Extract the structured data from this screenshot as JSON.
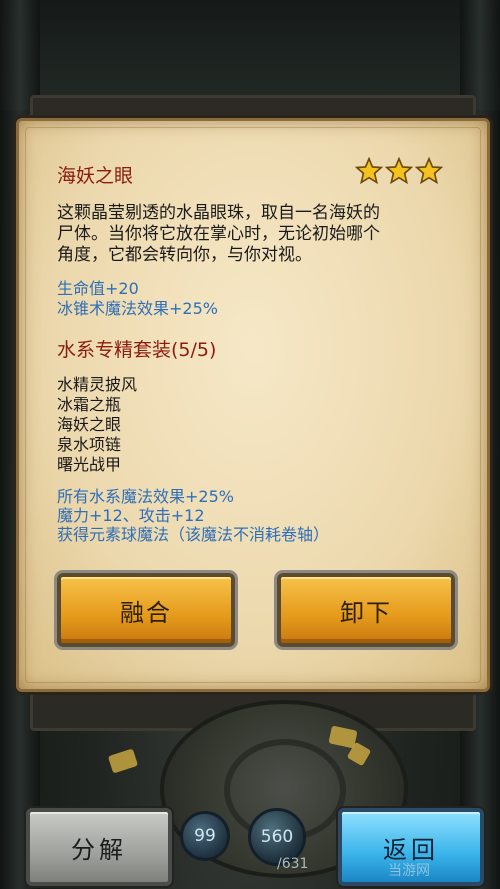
{
  "item": {
    "name": "海妖之眼",
    "star_count": 3,
    "description_lines": [
      "这颗晶莹剔透的水晶眼珠，取自一名海妖的",
      "尸体。当你将它放在掌心时，无论初始哪个",
      "角度，它都会转向你，与你对视。"
    ],
    "stats": [
      "生命值+20",
      "冰锥术魔法效果+25%"
    ]
  },
  "set": {
    "title": "水系专精套装(5/5)",
    "pieces": [
      "水精灵披风",
      "冰霜之瓶",
      "海妖之眼",
      "泉水项链",
      "曙光战甲"
    ],
    "bonuses": [
      "所有水系魔法效果+25%",
      "魔力+12、攻击+12",
      "获得元素球魔法（该魔法不消耗卷轴）"
    ]
  },
  "buttons": {
    "fuse": "融合",
    "unequip": "卸下",
    "decompose": "分解",
    "back": "返回"
  },
  "hud": {
    "mana": "99",
    "exp": "560",
    "exp_max": "/631"
  },
  "watermark": "当游网",
  "colors": {
    "title_red": "#8b1c10",
    "stat_blue": "#2f6fb8",
    "star_gold": "#f3c21f"
  }
}
